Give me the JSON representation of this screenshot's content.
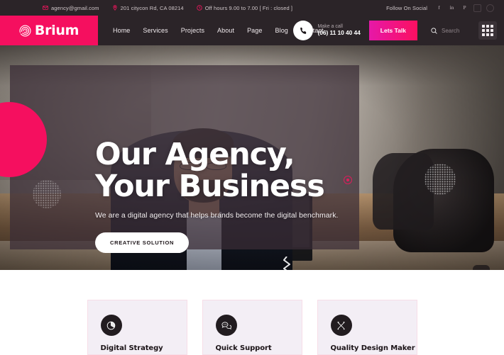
{
  "topbar": {
    "email": "agency@gmail.com",
    "email_icon": "envelope-icon",
    "address": "201 citycon Rd, CA 08214",
    "address_icon": "map-pin-icon",
    "hours": "Off hours 9.00 to 7.00 [ Fri : closed ]",
    "hours_icon": "clock-icon",
    "follow_label": "Follow On Social",
    "socials": [
      {
        "name": "facebook-icon",
        "glyph": "f"
      },
      {
        "name": "linkedin-icon",
        "glyph": "in"
      },
      {
        "name": "pinterest-icon",
        "glyph": "P"
      },
      {
        "name": "instagram-icon",
        "glyph": "□"
      },
      {
        "name": "dribbble-icon",
        "glyph": "◎"
      }
    ]
  },
  "header": {
    "logo_text": "Brium",
    "logo_icon": "spiral-target-icon",
    "nav": [
      {
        "label": "Home"
      },
      {
        "label": "Services"
      },
      {
        "label": "Projects"
      },
      {
        "label": "About"
      },
      {
        "label": "Page"
      },
      {
        "label": "Blog"
      },
      {
        "label": "Contact"
      }
    ],
    "call_icon": "phone-icon",
    "call_label": "Make a call",
    "call_number": "(06) 11 10 40 44",
    "cta_label": "Lets Talk",
    "search_icon": "search-icon",
    "search_placeholder": "Search",
    "search_value": "",
    "grid_icon": "apps-grid-icon"
  },
  "hero": {
    "title_line1": "Our Agency,",
    "title_line2": "Your Business",
    "subtitle": "We are a digital agency that helps brands become the digital benchmark.",
    "button_label": "CREATIVE SOLUTION",
    "next_icon": "arrow-right-icon",
    "prev_icon": "arrow-left-icon"
  },
  "services": {
    "cards": [
      {
        "title": "Digital Strategy",
        "icon": "pie-chart-icon"
      },
      {
        "title": "Quick Support",
        "icon": "chat-bubbles-icon"
      },
      {
        "title": "Quality Design Maker",
        "icon": "pen-ruler-icon"
      }
    ]
  },
  "colors": {
    "brand_pink": "#f50f5f",
    "brand_magenta": "#e618a8",
    "dark": "#221c20",
    "topbar_dark": "#2b2428",
    "card_bg": "#f3eef5",
    "card_border": "#f7dde8"
  }
}
